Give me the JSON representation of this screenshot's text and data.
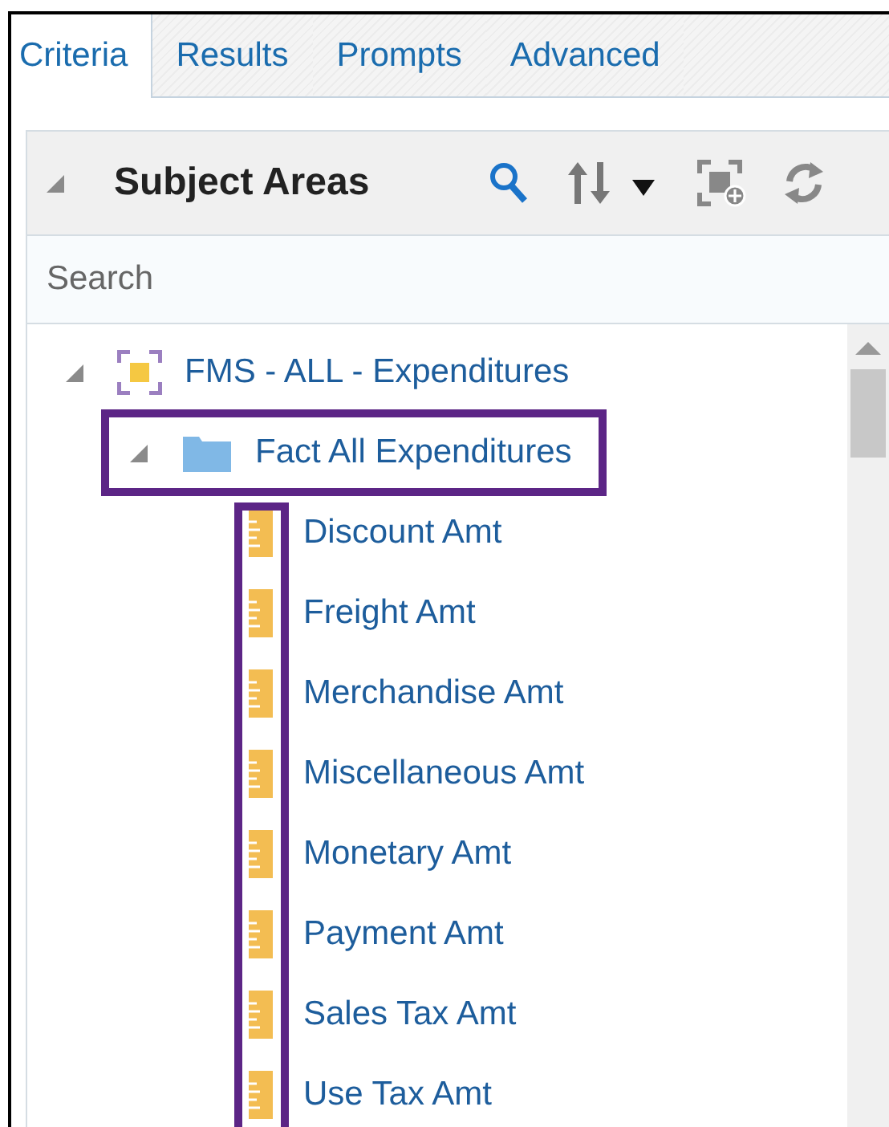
{
  "tabs": [
    {
      "label": "Criteria",
      "selected": true
    },
    {
      "label": "Results",
      "selected": false
    },
    {
      "label": "Prompts",
      "selected": false
    },
    {
      "label": "Advanced",
      "selected": false
    }
  ],
  "panel": {
    "title": "Subject Areas",
    "expanded": true
  },
  "search": {
    "placeholder": "Search"
  },
  "tree": [
    {
      "kind": "subject-area",
      "label": "FMS - ALL - Expenditures",
      "expanded": true,
      "children": [
        {
          "kind": "folder",
          "label": "Fact All Expenditures",
          "expanded": true,
          "highlighted": true,
          "icons_highlighted": true,
          "children": [
            {
              "kind": "measure",
              "label": "Discount Amt"
            },
            {
              "kind": "measure",
              "label": "Freight Amt"
            },
            {
              "kind": "measure",
              "label": "Merchandise Amt"
            },
            {
              "kind": "measure",
              "label": "Miscellaneous Amt"
            },
            {
              "kind": "measure",
              "label": "Monetary Amt"
            },
            {
              "kind": "measure",
              "label": "Payment Amt"
            },
            {
              "kind": "measure",
              "label": "Sales Tax Amt"
            },
            {
              "kind": "measure",
              "label": "Use Tax Amt"
            }
          ]
        }
      ]
    }
  ]
}
